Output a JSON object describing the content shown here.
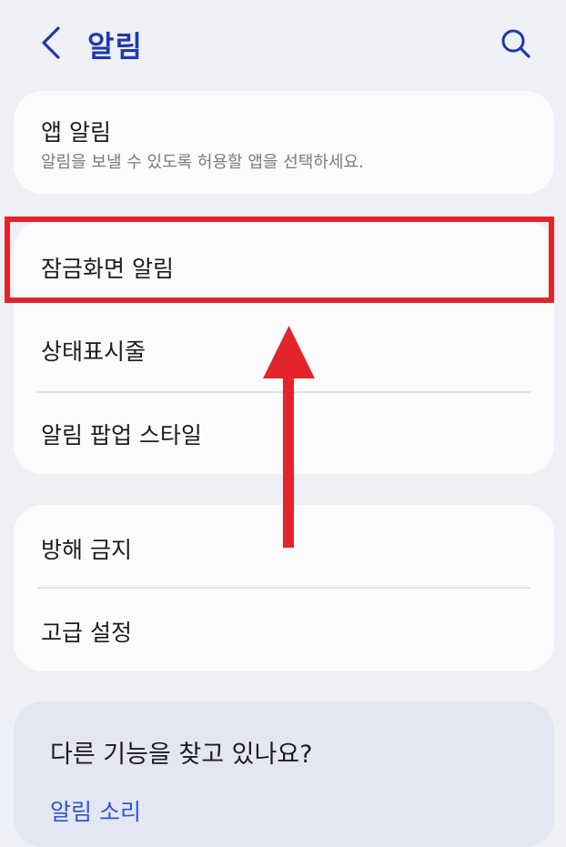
{
  "header": {
    "title": "알림",
    "back_icon": "chevron-left-icon",
    "search_icon": "search-icon",
    "accent_color": "#1f3aa6"
  },
  "app_notifications": {
    "label": "앱 알림",
    "description": "알림을 보낼 수 있도록 허용할 앱을 선택하세요."
  },
  "settings_group_1": {
    "items": [
      {
        "label": "잠금화면 알림"
      },
      {
        "label": "상태표시줄"
      },
      {
        "label": "알림 팝업 스타일"
      }
    ]
  },
  "settings_group_2": {
    "items": [
      {
        "label": "방해 금지"
      },
      {
        "label": "고급 설정"
      }
    ]
  },
  "looking_for_more": {
    "title": "다른 기능을 찾고 있나요?",
    "links": [
      {
        "label": "알림 소리",
        "color": "#2f56cf"
      }
    ]
  },
  "annotation": {
    "highlight_color": "#e3242b"
  }
}
